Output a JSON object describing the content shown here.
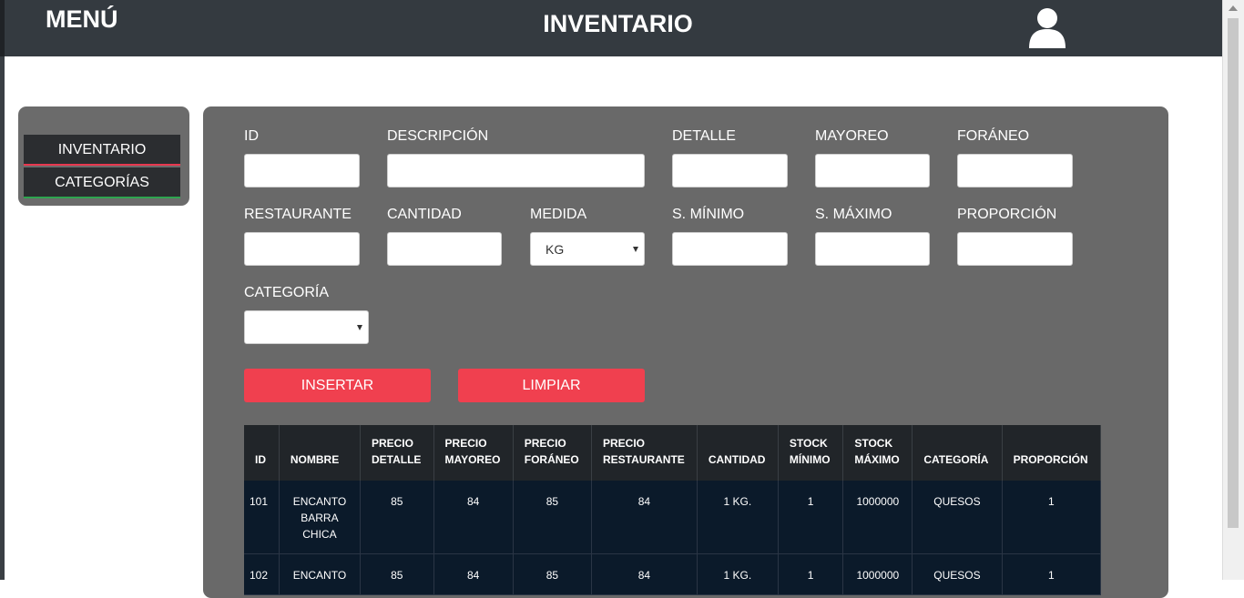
{
  "header": {
    "menu_label": "MENÚ",
    "title": "INVENTARIO"
  },
  "sidebar": {
    "items": [
      {
        "label": "INVENTARIO"
      },
      {
        "label": "CATEGORÍAS"
      }
    ]
  },
  "form": {
    "labels": {
      "id": "ID",
      "descripcion": "DESCRIPCIÓN",
      "detalle": "DETALLE",
      "mayoreo": "MAYOREO",
      "foraneo": "FORÁNEO",
      "restaurante": "RESTAURANTE",
      "cantidad": "CANTIDAD",
      "medida": "MEDIDA",
      "s_minimo": "S. MÍNIMO",
      "s_maximo": "S. MÁXIMO",
      "proporcion": "PROPORCIÓN",
      "categoria": "CATEGORÍA"
    },
    "values": {
      "id": "",
      "descripcion": "",
      "detalle": "",
      "mayoreo": "",
      "foraneo": "",
      "restaurante": "",
      "cantidad": "",
      "medida": "KG",
      "s_minimo": "",
      "s_maximo": "",
      "proporcion": "",
      "categoria": ""
    },
    "buttons": {
      "insertar": "INSERTAR",
      "limpiar": "LIMPIAR"
    }
  },
  "table": {
    "headers": [
      [
        "ID"
      ],
      [
        "NOMBRE"
      ],
      [
        "PRECIO",
        "DETALLE"
      ],
      [
        "PRECIO",
        "MAYOREO"
      ],
      [
        "PRECIO",
        "FORÁNEO"
      ],
      [
        "PRECIO",
        "RESTAURANTE"
      ],
      [
        "CANTIDAD"
      ],
      [
        "STOCK",
        "MÍNIMO"
      ],
      [
        "STOCK",
        "MÁXIMO"
      ],
      [
        "CATEGORÍA"
      ],
      [
        "PROPORCIÓN"
      ]
    ],
    "rows": [
      [
        "101",
        "ENCANTO BARRA CHICA",
        "85",
        "84",
        "85",
        "84",
        "1 KG.",
        "1",
        "1000000",
        "QUESOS",
        "1"
      ],
      [
        "102",
        "ENCANTO",
        "85",
        "84",
        "85",
        "84",
        "1 KG.",
        "1",
        "1000000",
        "QUESOS",
        "1"
      ]
    ]
  },
  "colors": {
    "accent": "#f0404f",
    "header_bg": "#343a40",
    "panel_bg": "#696969",
    "table_body_bg": "#0b1a2a"
  },
  "icons": {
    "user": "user-icon"
  }
}
